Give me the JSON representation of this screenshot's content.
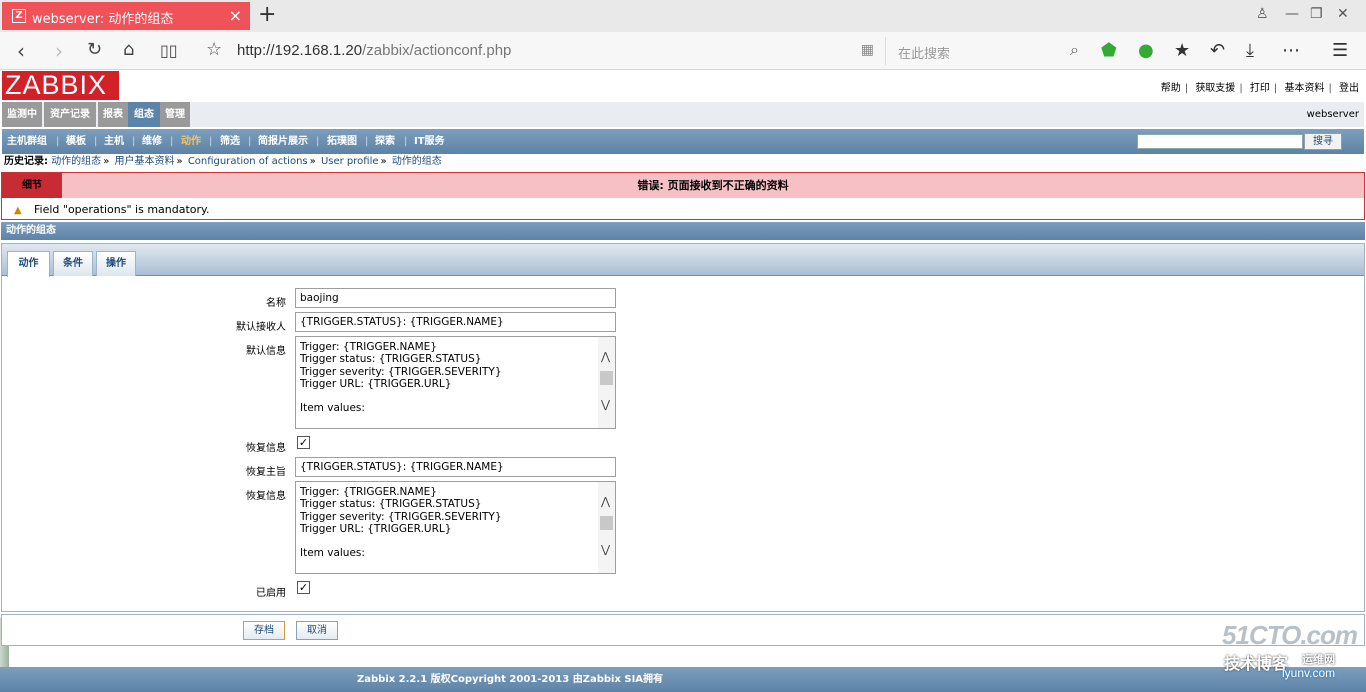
{
  "browser": {
    "tab_title": "webserver: 动作的组态",
    "favicon": "Z",
    "url_host": "http://192.168.1.20",
    "url_path": "/zabbix/actionconf.php",
    "search_placeholder": "在此搜索"
  },
  "header": {
    "logo": "ZABBIX",
    "links": [
      "帮助",
      "获取支援",
      "打印",
      "基本资料",
      "登出"
    ],
    "server": "webserver"
  },
  "main_menu": [
    "监测中",
    "资产记录",
    "报表",
    "组态",
    "管理"
  ],
  "sub_menu": [
    "主机群组",
    "模板",
    "主机",
    "维修",
    "动作",
    "筛选",
    "简报片展示",
    "拓璞图",
    "探索",
    "IT服务"
  ],
  "top_search_button": "搜寻",
  "history": {
    "label": "历史记录:",
    "items": [
      "动作的组态",
      "用户基本资料",
      "Configuration of actions",
      "User profile",
      "动作的组态"
    ]
  },
  "error": {
    "details_label": "细节",
    "title": "错误: 页面接收到不正确的资料",
    "message": "Field \"operations\" is mandatory."
  },
  "form": {
    "title": "动作的组态",
    "tabs": [
      "动作",
      "条件",
      "操作"
    ],
    "name_label": "名称",
    "name_value": "baojing",
    "default_subject_label": "默认接收人",
    "default_subject_value": "{TRIGGER.STATUS}: {TRIGGER.NAME}",
    "default_message_label": "默认信息",
    "default_message_lines": [
      "Trigger: {TRIGGER.NAME}",
      "Trigger status: {TRIGGER.STATUS}",
      "Trigger severity: {TRIGGER.SEVERITY}",
      "Trigger URL: {TRIGGER.URL}",
      "",
      "Item values:"
    ],
    "recovery_message_label": "恢复信息",
    "recovery_message_checked": true,
    "recovery_subject_label": "恢复主旨",
    "recovery_subject_value": "{TRIGGER.STATUS}: {TRIGGER.NAME}",
    "recovery_text_label": "恢复信息",
    "recovery_text_lines": [
      "Trigger: {TRIGGER.NAME}",
      "Trigger status: {TRIGGER.STATUS}",
      "Trigger severity: {TRIGGER.SEVERITY}",
      "Trigger URL: {TRIGGER.URL}",
      "",
      "Item values:"
    ],
    "enabled_label": "已启用",
    "enabled_checked": true
  },
  "buttons": {
    "save": "存档",
    "cancel": "取消"
  },
  "footer": "Zabbix 2.2.1 版权Copyright 2001-2013 由Zabbix SIA拥有",
  "watermark": {
    "brand": "51CTO.com",
    "tagline": "技术博客",
    "site": "iyunv.com",
    "badge": "运维网"
  }
}
